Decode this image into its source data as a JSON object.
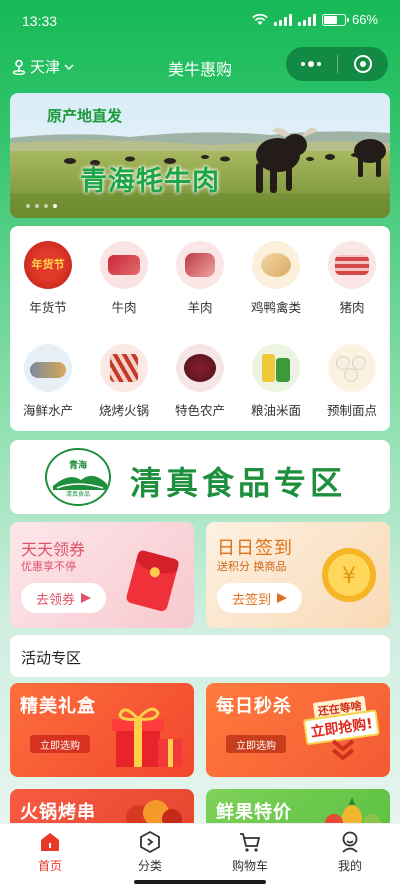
{
  "status": {
    "time": "13:33",
    "battery": "66%"
  },
  "nav": {
    "location": "天津",
    "title": "美牛惠购"
  },
  "banner": {
    "tag": "原产地直发",
    "title": "青海牦牛肉"
  },
  "categories": [
    {
      "label": "年货节",
      "icon": "new-year-festival-icon",
      "badge": "年货节"
    },
    {
      "label": "牛肉",
      "icon": "beef-icon"
    },
    {
      "label": "羊肉",
      "icon": "lamb-icon"
    },
    {
      "label": "鸡鸭禽类",
      "icon": "poultry-icon"
    },
    {
      "label": "猪肉",
      "icon": "pork-icon"
    },
    {
      "label": "海鲜水产",
      "icon": "seafood-icon"
    },
    {
      "label": "烧烤火锅",
      "icon": "bbq-hotpot-icon"
    },
    {
      "label": "特色农产",
      "icon": "farm-produce-icon"
    },
    {
      "label": "粮油米面",
      "icon": "grain-oil-icon"
    },
    {
      "label": "预制面点",
      "icon": "prepared-pastry-icon"
    }
  ],
  "halal": {
    "title": "清真食品专区",
    "logo_top": "青海",
    "logo_bottom": "清真食品"
  },
  "coupon": {
    "title": "天天领券",
    "subtitle": "优惠享不停",
    "button": "去领券"
  },
  "signin": {
    "title": "日日签到",
    "subtitle": "送积分 换商品",
    "button": "去签到"
  },
  "section": {
    "title": "活动专区"
  },
  "promos": {
    "gift": {
      "title": "精美礼盒",
      "button": "立即选购"
    },
    "flash": {
      "title": "每日秒杀",
      "button": "立即选购",
      "sticker_top": "还在等啥",
      "sticker_bottom": "立即抢购!"
    },
    "hotpot": {
      "title": "火锅烤串"
    },
    "fruit": {
      "title": "鲜果特价"
    }
  },
  "tabs": [
    {
      "label": "首页",
      "icon": "home-icon",
      "active": true
    },
    {
      "label": "分类",
      "icon": "category-icon",
      "active": false
    },
    {
      "label": "购物车",
      "icon": "cart-icon",
      "active": false
    },
    {
      "label": "我的",
      "icon": "profile-icon",
      "active": false
    }
  ],
  "colors": {
    "brand_green": "#1aba58",
    "accent_red": "#e8382a",
    "halal_green": "#1d8f3d"
  }
}
